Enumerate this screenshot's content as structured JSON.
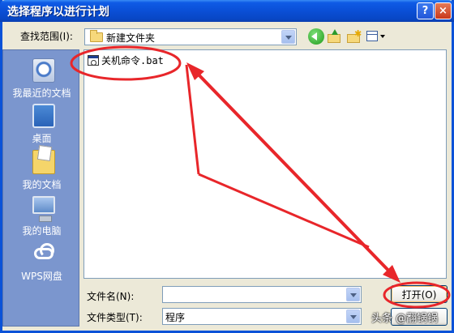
{
  "window": {
    "title": "选择程序以进行计划",
    "help_label": "?",
    "close_label": "×"
  },
  "lookin": {
    "label": "查找范围(I):",
    "value": "新建文件夹"
  },
  "places": [
    {
      "label": "我最近的文档",
      "icon": "recent-documents-icon"
    },
    {
      "label": "桌面",
      "icon": "desktop-icon"
    },
    {
      "label": "我的文档",
      "icon": "my-documents-icon"
    },
    {
      "label": "我的电脑",
      "icon": "my-computer-icon"
    },
    {
      "label": "WPS网盘",
      "icon": "wps-cloud-icon"
    }
  ],
  "files": [
    {
      "name": "关机命令.bat",
      "icon": "batch-file-icon"
    }
  ],
  "filename": {
    "label": "文件名(N):",
    "value": ""
  },
  "filetype": {
    "label": "文件类型(T):",
    "value": "程序"
  },
  "buttons": {
    "open_label": "打开(O)"
  },
  "watermark": "头条 @翻锅锅",
  "colors": {
    "titlebar": "#0a4fd6",
    "places_bar": "#7b96ce",
    "annotation": "#e8262a"
  }
}
